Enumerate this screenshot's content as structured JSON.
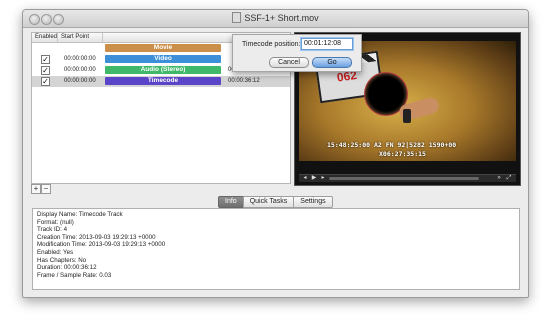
{
  "window": {
    "title": "SSF-1+ Short.mov",
    "title_icon": "movie-file-icon"
  },
  "track_table": {
    "headers": {
      "enabled": "Enabled",
      "start_point": "Start Point"
    },
    "rows": [
      {
        "enabled": null,
        "start": "",
        "name": "Movie",
        "duration": "",
        "color": "#cc8f4a"
      },
      {
        "enabled": true,
        "start": "00:00:00:00",
        "name": "Video",
        "duration": "",
        "color": "#3d8fd8"
      },
      {
        "enabled": true,
        "start": "00:00:00:00",
        "name": "Audio (Stereo)",
        "duration": "00:00:36:12",
        "color": "#3fb86a"
      },
      {
        "enabled": true,
        "start": "00:00:00:00",
        "name": "Timecode",
        "duration": "00:00:36:12",
        "color": "#5a44c8",
        "selected": true
      }
    ],
    "check_glyph": "✓",
    "add_label": "+",
    "remove_label": "−"
  },
  "video": {
    "timecode_overlay_1": "15:48:25:00 A2 FN 92|5282 1590+00",
    "timecode_overlay_2": "X06:27:35:15",
    "clapper_text": "062"
  },
  "tabs": {
    "info": "Info",
    "quick_tasks": "Quick Tasks",
    "settings": "Settings",
    "active": "Info"
  },
  "info": {
    "lines": [
      "Display Name: Timecode Track",
      "Format: (null)",
      "Track ID: 4",
      "Creation Time: 2013-09-03 19:29:13 +0000",
      "Modification Time: 2013-09-03 19:29:13 +0000",
      "Enabled: Yes",
      "Has Chapters: No",
      "Duration: 00:00:36:12",
      "Frame / Sample Rate: 0.03"
    ]
  },
  "timecode_sheet": {
    "label": "Timecode position:",
    "value": "00:01:12:08",
    "cancel_label": "Cancel",
    "go_label": "Go"
  }
}
